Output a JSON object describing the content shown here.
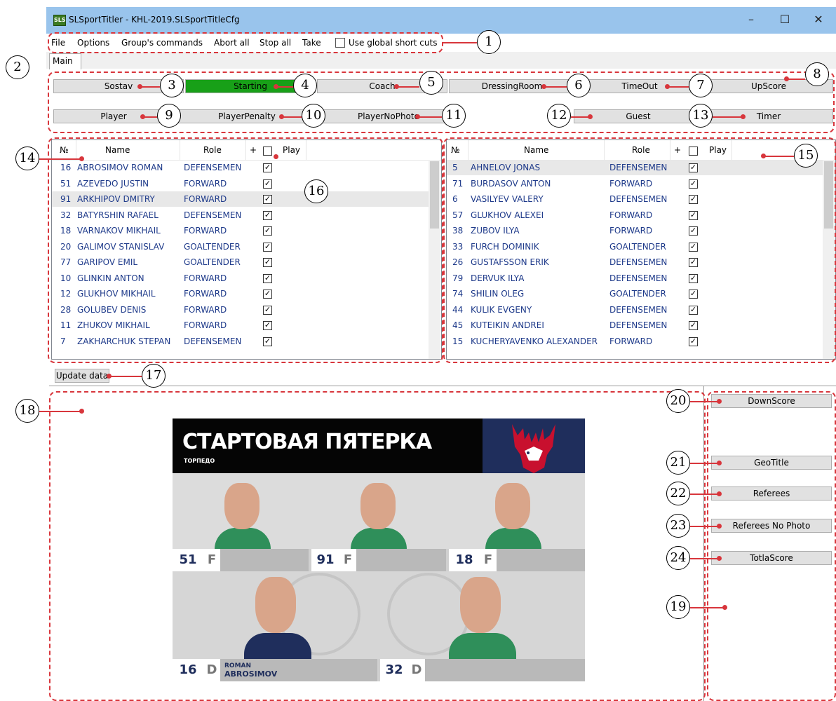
{
  "window": {
    "title": "SLSportTitler - KHL-2019.SLSportTitleCfg",
    "app_icon_text": "SLS",
    "controls": [
      "–",
      "☐",
      "✕"
    ]
  },
  "menu": {
    "items": [
      "File",
      "Options",
      "Group's commands",
      "Abort all",
      "Stop all",
      "Take"
    ],
    "global_shortcuts_label": "Use global short cuts"
  },
  "tabs": {
    "main": "Main"
  },
  "buttons_row1": [
    "Sostav",
    "Starting",
    "Coach",
    "DressingRoom",
    "TimeOut",
    "UpScore"
  ],
  "buttons_row2": [
    "Player",
    "PlayerPenalty",
    "PlayerNoPhoto",
    "Guest",
    "Timer"
  ],
  "grid_headers": {
    "num": "№",
    "name": "Name",
    "role": "Role",
    "plus": "+",
    "play": "Play"
  },
  "home_players": [
    {
      "num": "16",
      "name": "ABROSIMOV ROMAN",
      "role": "DEFENSEMEN",
      "play": true
    },
    {
      "num": "51",
      "name": "AZEVEDO JUSTIN",
      "role": "FORWARD",
      "play": true
    },
    {
      "num": "91",
      "name": "ARKHIPOV DMITRY",
      "role": "FORWARD",
      "play": true
    },
    {
      "num": "32",
      "name": "BATYRSHIN RAFAEL",
      "role": "DEFENSEMEN",
      "play": true
    },
    {
      "num": "18",
      "name": "VARNAKOV MIKHAIL",
      "role": "FORWARD",
      "play": true
    },
    {
      "num": "20",
      "name": "GALIMOV STANISLAV",
      "role": "GOALTENDER",
      "play": true
    },
    {
      "num": "77",
      "name": "GARIPOV EMIL",
      "role": "GOALTENDER",
      "play": true
    },
    {
      "num": "10",
      "name": "GLINKIN ANTON",
      "role": "FORWARD",
      "play": true
    },
    {
      "num": "12",
      "name": "GLUKHOV MIKHAIL",
      "role": "FORWARD",
      "play": true
    },
    {
      "num": "28",
      "name": "GOLUBEV DENIS",
      "role": "FORWARD",
      "play": true
    },
    {
      "num": "11",
      "name": "ZHUKOV MIKHAIL",
      "role": "FORWARD",
      "play": true
    },
    {
      "num": "7",
      "name": "ZAKHARCHUK STEPAN",
      "role": "DEFENSEMEN",
      "play": true
    }
  ],
  "guest_players": [
    {
      "num": "5",
      "name": "AHNELOV JONAS",
      "role": "DEFENSEMEN",
      "play": true
    },
    {
      "num": "71",
      "name": "BURDASOV ANTON",
      "role": "FORWARD",
      "play": true
    },
    {
      "num": "6",
      "name": "VASILYEV VALERY",
      "role": "DEFENSEMEN",
      "play": true
    },
    {
      "num": "57",
      "name": "GLUKHOV ALEXEI",
      "role": "FORWARD",
      "play": true
    },
    {
      "num": "38",
      "name": "ZUBOV ILYA",
      "role": "FORWARD",
      "play": true
    },
    {
      "num": "33",
      "name": "FURCH DOMINIK",
      "role": "GOALTENDER",
      "play": true
    },
    {
      "num": "26",
      "name": "GUSTAFSSON ERIK",
      "role": "DEFENSEMEN",
      "play": true
    },
    {
      "num": "79",
      "name": "DERVUK ILYA",
      "role": "DEFENSEMEN",
      "play": true
    },
    {
      "num": "74",
      "name": "SHILIN OLEG",
      "role": "GOALTENDER",
      "play": true
    },
    {
      "num": "44",
      "name": "KULIK EVGENY",
      "role": "DEFENSEMEN",
      "play": true
    },
    {
      "num": "45",
      "name": "KUTEIKIN ANDREI",
      "role": "DEFENSEMEN",
      "play": true
    },
    {
      "num": "15",
      "name": "KUCHERYAVENKO ALEXANDER",
      "role": "FORWARD",
      "play": true
    }
  ],
  "update_button": "Update data",
  "side_buttons": [
    "DownScore",
    "GeoTitle",
    "Referees",
    "Referees No Photo",
    "TotlaScore"
  ],
  "preview": {
    "title": "СТАРТОВАЯ ПЯТЕРКА",
    "subtitle": "ТОРПЕДО",
    "row1": [
      {
        "num": "51",
        "pos": "F"
      },
      {
        "num": "91",
        "pos": "F"
      },
      {
        "num": "18",
        "pos": "F"
      }
    ],
    "row2": [
      {
        "num": "16",
        "pos": "D",
        "first": "ROMAN",
        "last": "ABROSIMOV"
      },
      {
        "num": "32",
        "pos": "D"
      }
    ]
  },
  "callouts": [
    "1",
    "2",
    "3",
    "4",
    "5",
    "6",
    "7",
    "8",
    "9",
    "10",
    "11",
    "12",
    "13",
    "14",
    "15",
    "16",
    "17",
    "18",
    "19",
    "20",
    "21",
    "22",
    "23",
    "24"
  ],
  "colors": {
    "titlebar": "#99c4ec",
    "starting_active": "#18a018",
    "callout_line": "#d8363c",
    "preview_navy": "#1f2e5c",
    "jersey_green": "#2f8f5a"
  }
}
